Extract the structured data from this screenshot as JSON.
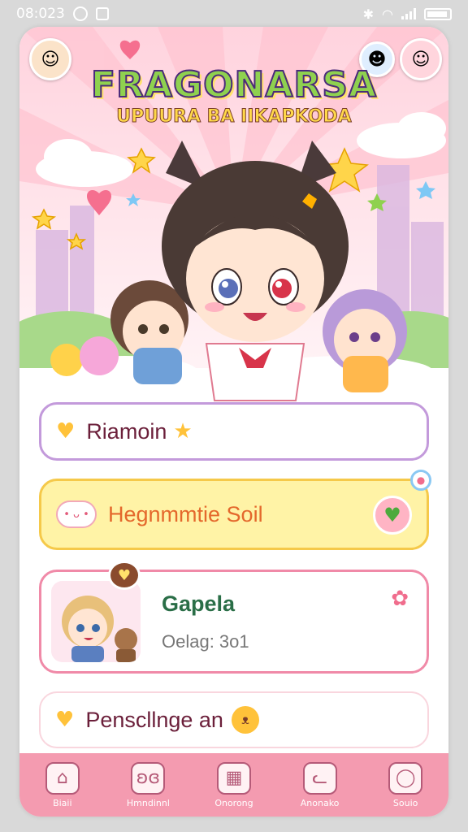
{
  "status_bar": {
    "time": "08:023"
  },
  "header": {
    "title": "FRAGONARSA",
    "subtitle": "UPUURA BA IIKAPKODA"
  },
  "menu": {
    "item1": {
      "label": "Riamoin",
      "icon": "heart-icon"
    },
    "item2": {
      "label": "Hegnmmtie Soil",
      "icon": "cloud-icon"
    },
    "item3": {
      "title": "Gapela",
      "meta": "Oelag: 3o1",
      "icon": "puzzle-icon"
    },
    "item4": {
      "label": "Penscllnge an",
      "icon": "heart-icon"
    }
  },
  "tabs": [
    {
      "label": "Biaii",
      "icon": "home-icon"
    },
    {
      "label": "Hmndinnl",
      "icon": "bunny-icon"
    },
    {
      "label": "Onorong",
      "icon": "calendar-icon"
    },
    {
      "label": "Anonako",
      "icon": "cat-icon"
    },
    {
      "label": "Souio",
      "icon": "profile-icon"
    }
  ],
  "colors": {
    "tab_bar": "#f49bb0",
    "card_yellow": "#fff3a6",
    "card_purple_border": "#c39adb",
    "card_pink_border": "#f08aa8",
    "title_green": "#8fd14f"
  }
}
